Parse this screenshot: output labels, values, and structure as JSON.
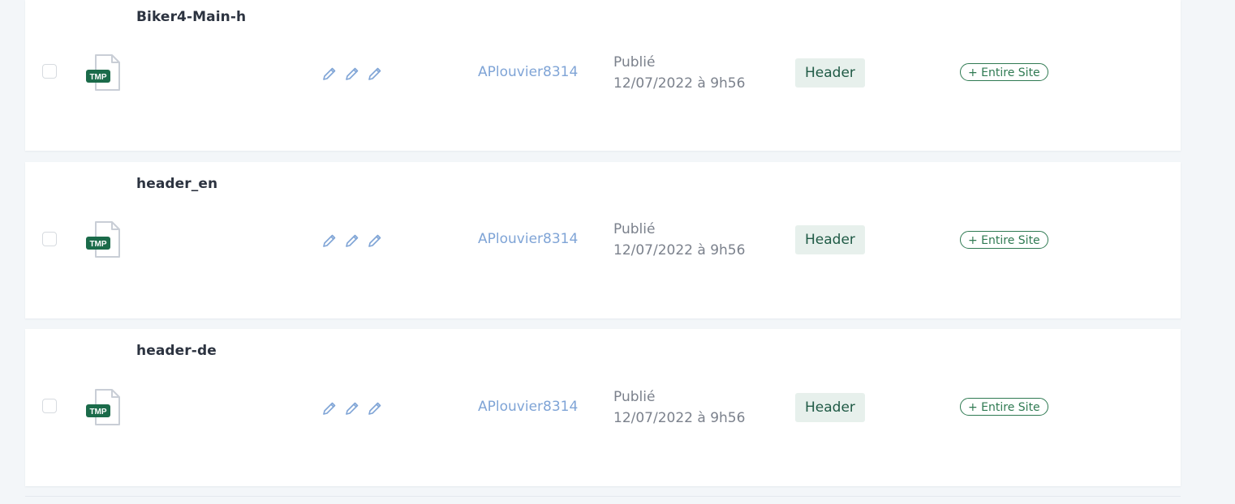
{
  "colors": {
    "page_background": "#f3f6f9",
    "card_background": "#ffffff",
    "author_link": "#7fa4d6",
    "badge_background": "#e7f0ec",
    "badge_text": "#1f5a45",
    "scope_pill": "#2f7a52",
    "file_icon_badge": "#1b6b4a"
  },
  "file_icon": {
    "icon": "tmp-file-icon",
    "label": "TMP"
  },
  "rows": [
    {
      "title": "Biker4-Main-h",
      "author": "APlouvier8314",
      "status": "Publié",
      "date": "12/07/2022 à 9h56",
      "type": "Header",
      "scope": "+ Entire Site"
    },
    {
      "title": "header_en",
      "author": "APlouvier8314",
      "status": "Publié",
      "date": "12/07/2022 à 9h56",
      "type": "Header",
      "scope": "+ Entire Site"
    },
    {
      "title": "header-de",
      "author": "APlouvier8314",
      "status": "Publié",
      "date": "12/07/2022 à 9h56",
      "type": "Header",
      "scope": "+ Entire Site"
    }
  ]
}
